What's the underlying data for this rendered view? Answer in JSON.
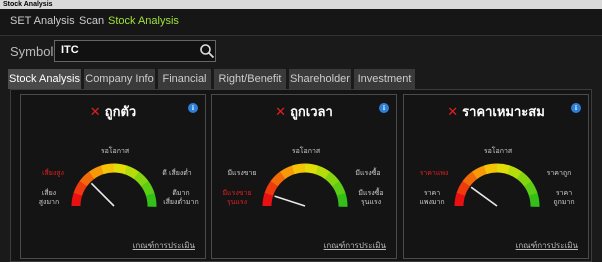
{
  "window": {
    "title": "Stock Analysis"
  },
  "nav": [
    "SET Analysis",
    "Scan",
    "Stock Analysis"
  ],
  "symbol": {
    "label": "Symbol",
    "value": "ITC"
  },
  "tabs": [
    "Stock Analysis",
    "Company Info",
    "Financial",
    "Right/Benefit",
    "Shareholder",
    "Investment"
  ],
  "cards": [
    {
      "title": "ถูกตัว",
      "top_center": "รอโอกาส",
      "left_upper": "เสี่ยงสูง",
      "right_upper": "ดี เสี่ยงต่ำ",
      "left_lower": [
        "เสี่ยง",
        "สูงมาก"
      ],
      "right_lower": [
        "ดีมาก",
        "เสี่ยงต่ำมาก"
      ],
      "criteria": "เกณฑ์การประเมิน",
      "needle_level": 0.25
    },
    {
      "title": "ถูกเวลา",
      "top_center": "รอโอกาส",
      "left_upper": "มีแรงขาย",
      "right_upper": "มีแรงซื้อ",
      "left_lower": [
        "มีแรงขาย",
        "รุนแรง"
      ],
      "right_lower": [
        "มีแรงซื้อ",
        "รุนแรง"
      ],
      "criteria": "เกณฑ์การประเมิน",
      "needle_level": 0.1
    },
    {
      "title": "ราคาเหมาะสม",
      "top_center": "รอโอกาส",
      "left_upper": "ราคาแพง",
      "right_upper": "ราคาถูก",
      "left_lower": [
        "ราคา",
        "แพงมาก"
      ],
      "right_lower": [
        "ราคา",
        "ถูกมาก"
      ],
      "criteria": "เกณฑ์การประเมิน",
      "needle_level": 0.2
    }
  ],
  "colors": {
    "accent": "#9ee33b",
    "bad": "#e02020",
    "info": "#2e7fd6"
  },
  "icons": {
    "search": "search-icon",
    "info": "info-icon",
    "fail": "x-icon"
  }
}
